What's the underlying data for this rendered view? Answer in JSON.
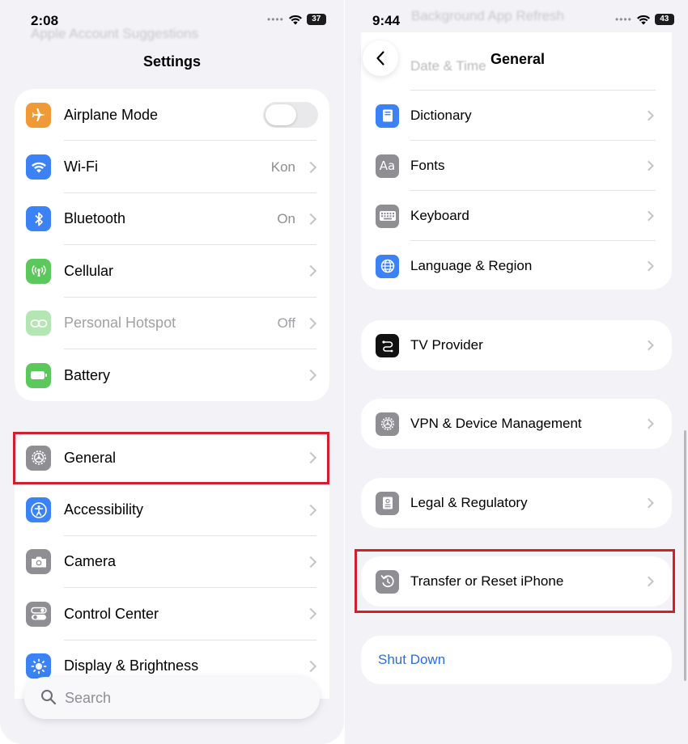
{
  "left": {
    "status": {
      "time": "2:08",
      "battery": "37"
    },
    "ghost_text": "Apple Account Suggestions",
    "title": "Settings",
    "group1": [
      {
        "label": "Airplane Mode",
        "value": "",
        "icon": "airplane-icon",
        "color": "#f09a37",
        "toggle": true
      },
      {
        "label": "Wi-Fi",
        "value": "Kon",
        "icon": "wifi-icon",
        "color": "#3a82f6"
      },
      {
        "label": "Bluetooth",
        "value": "On",
        "icon": "bluetooth-icon",
        "color": "#3a82f6"
      },
      {
        "label": "Cellular",
        "value": "",
        "icon": "cellular-icon",
        "color": "#5ac85a"
      },
      {
        "label": "Personal Hotspot",
        "value": "Off",
        "icon": "hotspot-icon",
        "color": "#5ac85a",
        "dim": true
      },
      {
        "label": "Battery",
        "value": "",
        "icon": "battery-icon",
        "color": "#5ac85a"
      }
    ],
    "group2": [
      {
        "label": "General",
        "icon": "gear-icon",
        "color": "#8e8e93"
      },
      {
        "label": "Accessibility",
        "icon": "accessibility-icon",
        "color": "#3a82f6"
      },
      {
        "label": "Camera",
        "icon": "camera-icon",
        "color": "#8e8e93"
      },
      {
        "label": "Control Center",
        "icon": "control-center-icon",
        "color": "#8e8e93"
      },
      {
        "label": "Display & Brightness",
        "icon": "sun-icon",
        "color": "#3a82f6"
      }
    ],
    "search_placeholder": "Search"
  },
  "right": {
    "status": {
      "time": "9:44",
      "battery": "43"
    },
    "ghost_top": "Background App Refresh",
    "ghost_date": "Date & Time",
    "title": "General",
    "group1": [
      {
        "label": "Dictionary",
        "icon": "dictionary-icon",
        "color": "#3a82f6"
      },
      {
        "label": "Fonts",
        "icon": "fonts-icon",
        "color": "#8e8e93"
      },
      {
        "label": "Keyboard",
        "icon": "keyboard-icon",
        "color": "#8e8e93"
      },
      {
        "label": "Language & Region",
        "icon": "globe-icon",
        "color": "#3a82f6"
      }
    ],
    "tv_provider": "TV Provider",
    "vpn": "VPN & Device Management",
    "legal": "Legal & Regulatory",
    "transfer": "Transfer or Reset iPhone",
    "shutdown": "Shut Down",
    "accent": "#2b6fd6",
    "highlight_color": "#d0202e"
  }
}
